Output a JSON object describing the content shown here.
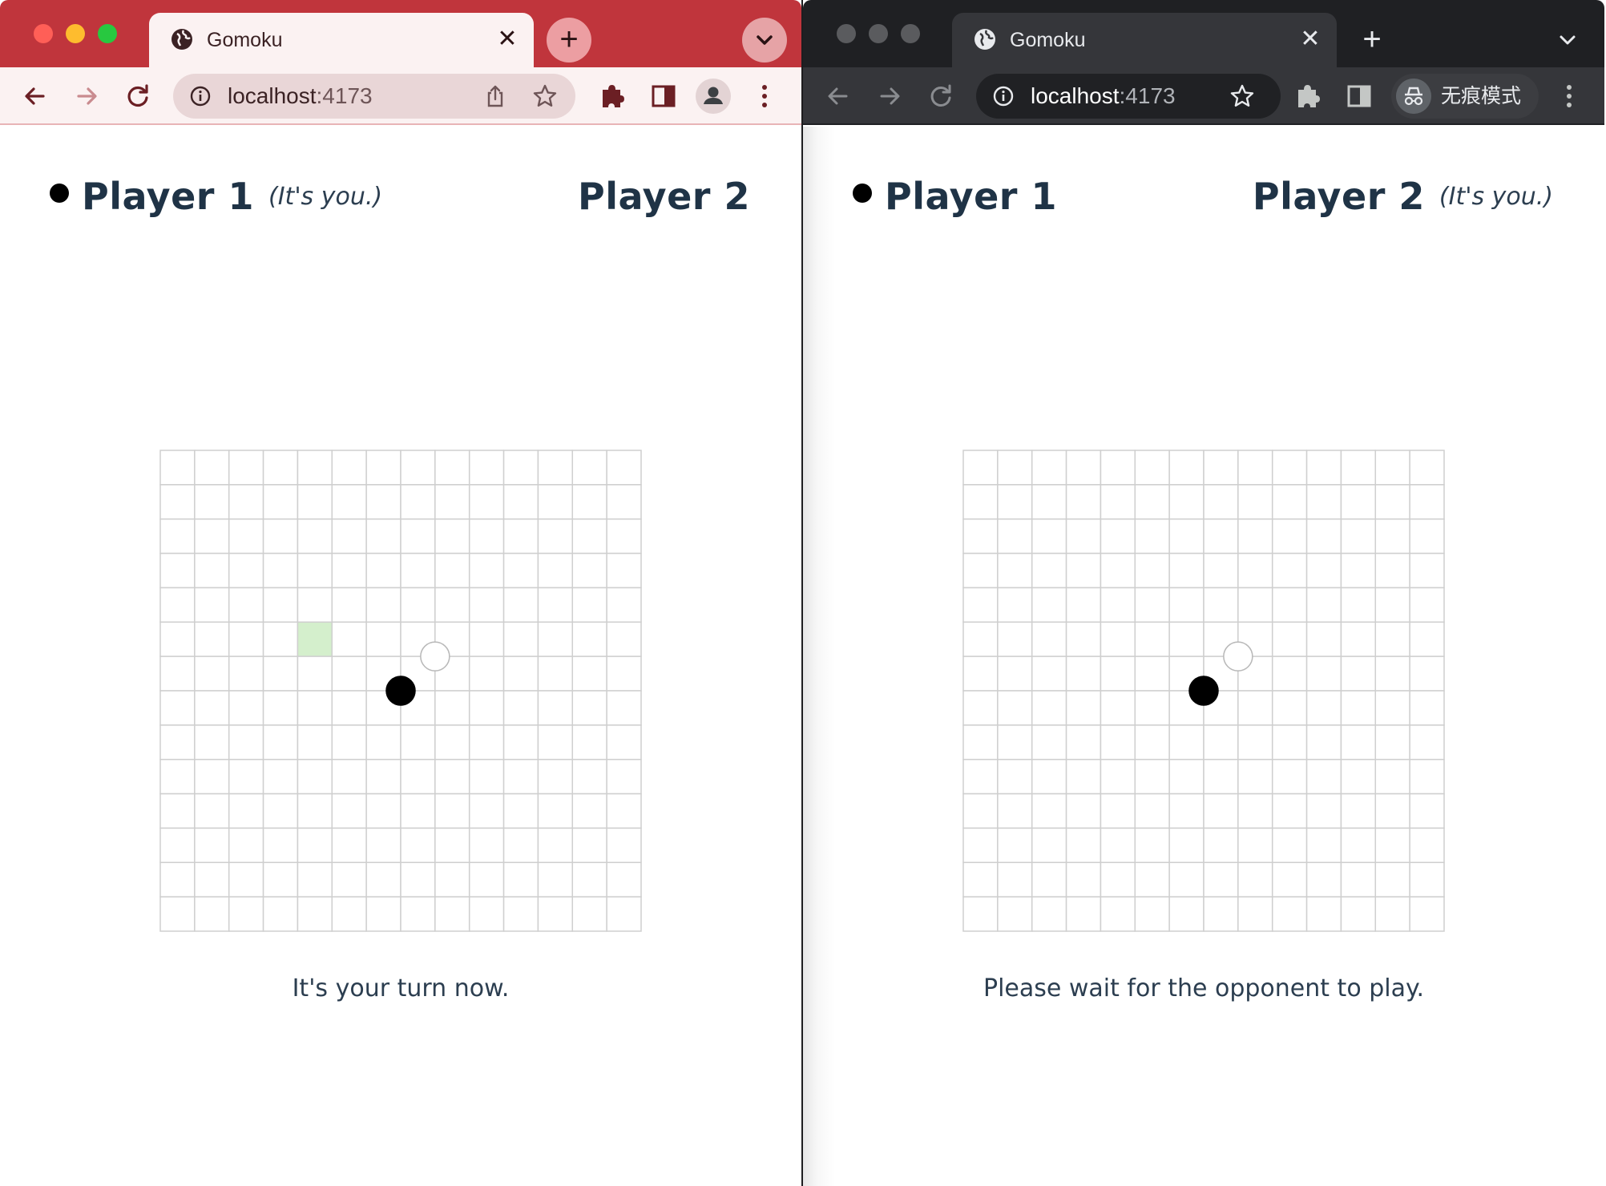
{
  "windows": [
    {
      "theme": "normal",
      "tab_title": "Gomoku",
      "url_host": "localhost",
      "url_port": ":4173",
      "incognito_label": "",
      "player1": {
        "name": "Player 1",
        "suffix": "(It's you.)"
      },
      "player2": {
        "name": "Player 2",
        "suffix": ""
      },
      "status": "It's your turn now.",
      "board": {
        "size": 14,
        "stones": [
          {
            "col": 7,
            "row": 7,
            "color": "black"
          },
          {
            "col": 8,
            "row": 6,
            "color": "white"
          }
        ],
        "highlight": {
          "col": 4,
          "row": 5,
          "color": "#d4efcc"
        }
      }
    },
    {
      "theme": "incognito",
      "tab_title": "Gomoku",
      "url_host": "localhost",
      "url_port": ":4173",
      "incognito_label": "无痕模式",
      "player1": {
        "name": "Player 1",
        "suffix": ""
      },
      "player2": {
        "name": "Player 2",
        "suffix": "(It's you.)"
      },
      "status": "Please wait for the opponent to play.",
      "board": {
        "size": 14,
        "stones": [
          {
            "col": 7,
            "row": 7,
            "color": "black"
          },
          {
            "col": 8,
            "row": 6,
            "color": "white"
          }
        ],
        "highlight": null
      }
    }
  ],
  "colors": {
    "left_tabstrip": "#c0353c",
    "right_tabstrip": "#1f2023",
    "text_dark": "#1f3346",
    "grid_line": "#cfcfcf"
  },
  "icons": {
    "tab_favicon": "globe-icon",
    "back": "arrow-left-icon",
    "forward": "arrow-right-icon",
    "reload": "reload-icon",
    "site_info": "info-icon",
    "share": "share-icon",
    "bookmark": "star-icon",
    "extensions": "puzzle-icon",
    "side_panel": "side-panel-icon",
    "profile": "profile-icon",
    "menu": "kebab-menu-icon",
    "incognito": "incognito-icon"
  }
}
